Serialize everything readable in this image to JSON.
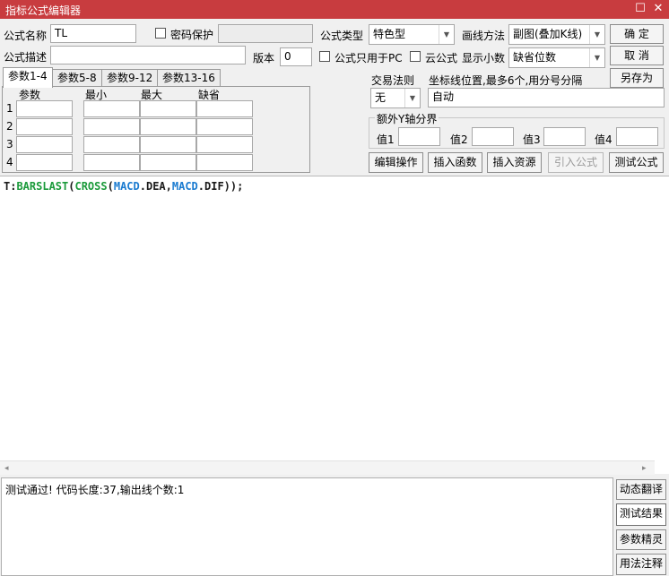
{
  "window": {
    "title": "指标公式编辑器",
    "restore_glyph": "☐",
    "close_glyph": "✕"
  },
  "form": {
    "name_label": "公式名称",
    "name_value": "TL",
    "password_label": "密码保护",
    "desc_label": "公式描述",
    "desc_value": "",
    "version_label": "版本",
    "version_value": "0",
    "type_label": "公式类型",
    "type_value": "特色型",
    "draw_label": "画线方法",
    "draw_value": "副图(叠加K线)",
    "pc_only_label": "公式只用于PC",
    "cloud_label": "云公式",
    "decimals_label": "显示小数",
    "decimals_value": "缺省位数",
    "trade_rule_label": "交易法则",
    "trade_rule_value": "无",
    "coord_label": "坐标线位置,最多6个,用分号分隔",
    "coord_value": "自动",
    "yaxis_label": "额外Y轴分界",
    "y1_label": "值1",
    "y2_label": "值2",
    "y3_label": "值3",
    "y4_label": "值4"
  },
  "buttons": {
    "ok": "确  定",
    "cancel": "取  消",
    "save_as": "另存为",
    "edit_op": "编辑操作",
    "insert_func": "插入函数",
    "insert_res": "插入资源",
    "import_formula": "引入公式",
    "test_formula": "测试公式",
    "dynamic_translate": "动态翻译",
    "test_result": "测试结果",
    "param_wizard": "参数精灵",
    "usage_notes": "用法注释"
  },
  "tabs": [
    "参数1-4",
    "参数5-8",
    "参数9-12",
    "参数13-16"
  ],
  "params": {
    "headers": [
      "参数",
      "最小",
      "最大",
      "缺省"
    ],
    "rows": [
      "1",
      "2",
      "3",
      "4"
    ]
  },
  "code": {
    "tokens": [
      {
        "text": "T:",
        "color": "#1a1a1a"
      },
      {
        "text": "BARSLAST",
        "color": "#1a9a3a"
      },
      {
        "text": "(",
        "color": "#1a1a1a"
      },
      {
        "text": "CROSS",
        "color": "#1a9a3a"
      },
      {
        "text": "(",
        "color": "#1a1a1a"
      },
      {
        "text": "MACD",
        "color": "#1a7bd0"
      },
      {
        "text": ".DEA,",
        "color": "#1a1a1a"
      },
      {
        "text": "MACD",
        "color": "#1a7bd0"
      },
      {
        "text": ".DIF));",
        "color": "#1a1a1a"
      }
    ]
  },
  "scroll": {
    "left": "◂",
    "right": "▸"
  },
  "output": {
    "text": "测试通过! 代码长度:37,输出线个数:1"
  },
  "icons": {
    "dropdown": "▼"
  }
}
